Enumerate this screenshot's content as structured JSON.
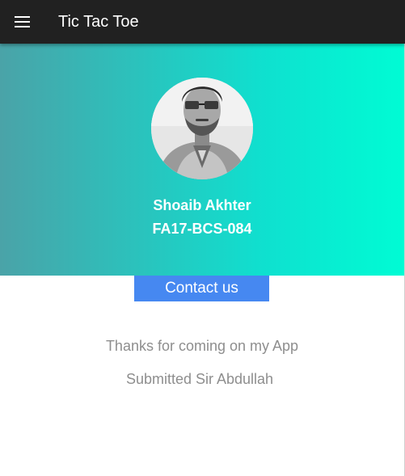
{
  "appbar": {
    "title": "Tic Tac Toe",
    "menu_icon": "hamburger-menu-icon",
    "background": "#212121"
  },
  "profile": {
    "avatar_icon": "profile-photo",
    "name": "Shoaib Akhter",
    "id": "FA17-BCS-084",
    "gradient_start": "#4aa3a8",
    "gradient_end": "#00fcd4"
  },
  "actions": {
    "contact_label": "Contact us",
    "contact_color": "#4688f1"
  },
  "messages": {
    "thanks": "Thanks for coming on my App",
    "submitted": "Submitted Sir Abdullah"
  }
}
